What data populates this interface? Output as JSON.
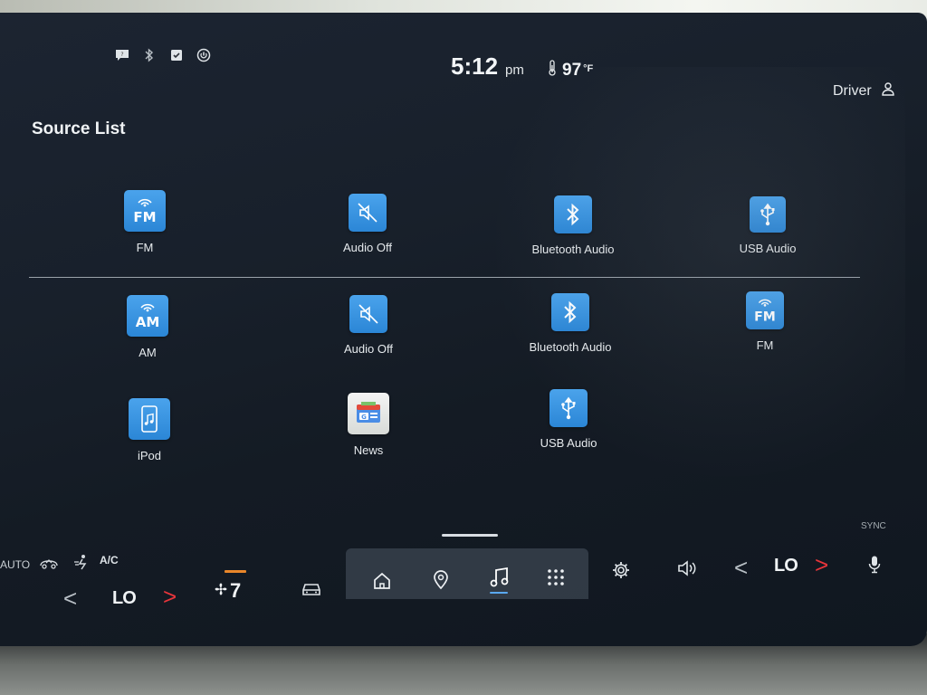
{
  "status": {
    "time": "5:12",
    "ampm": "pm",
    "temperature": "97",
    "temp_unit": "°F",
    "driver": "Driver"
  },
  "page_title": "Source List",
  "recent_sources": [
    {
      "label": "FM",
      "icon": "fm-radio-icon",
      "tile_text": "FM"
    },
    {
      "label": "Audio Off",
      "icon": "audio-off-icon"
    },
    {
      "label": "Bluetooth Audio",
      "icon": "bluetooth-icon"
    },
    {
      "label": "USB Audio",
      "icon": "usb-icon"
    }
  ],
  "all_sources": [
    {
      "label": "AM",
      "icon": "am-radio-icon",
      "tile_text": "AM"
    },
    {
      "label": "Audio Off",
      "icon": "audio-off-icon"
    },
    {
      "label": "Bluetooth Audio",
      "icon": "bluetooth-icon"
    },
    {
      "label": "FM",
      "icon": "fm-radio-icon",
      "tile_text": "FM"
    },
    {
      "label": "iPod",
      "icon": "ipod-icon"
    },
    {
      "label": "News",
      "icon": "news-icon"
    },
    {
      "label": "USB Audio",
      "icon": "usb-icon"
    }
  ],
  "climate": {
    "auto_label": "AUTO",
    "ac_label": "A/C",
    "left_temp": "LO",
    "right_temp": "LO",
    "fan_speed": "7",
    "left_arrow": "<",
    "right_arrow": ">"
  },
  "sync_label": "SYNC",
  "colors": {
    "tile_blue": "#3a95e2",
    "accent_red": "#e8353b",
    "fan_orange": "#e9862a",
    "active_blue": "#5aa9f0"
  }
}
